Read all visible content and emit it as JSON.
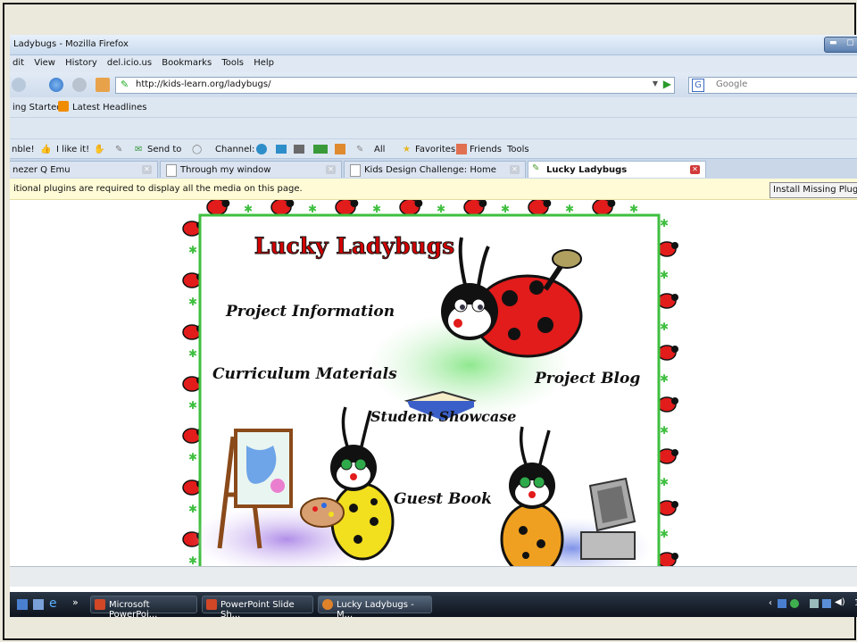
{
  "window": {
    "title": "Ladybugs - Mozilla Firefox"
  },
  "menu": [
    "dit",
    "View",
    "History",
    "del.icio.us",
    "Bookmarks",
    "Tools",
    "Help"
  ],
  "nav": {
    "url": "http://kids-learn.org/ladybugs/",
    "search_placeholder": "Google"
  },
  "bookmarks": {
    "getting_started": "ing Started",
    "latest_headlines": "Latest Headlines"
  },
  "extension_bar": {
    "stumble": "nble!",
    "i_like_it": "I like it!",
    "send_to": "Send to",
    "channel": "Channel:",
    "all": "All",
    "favorites": "Favorites",
    "friends": "Friends",
    "tools": "Tools"
  },
  "tabs": [
    {
      "label": "nezer Q Emu"
    },
    {
      "label": "Through my window"
    },
    {
      "label": "Kids Design Challenge: Home"
    },
    {
      "label": "Lucky Ladybugs"
    }
  ],
  "notification": {
    "message": "itional plugins are required to display all the media on this page.",
    "button": "Install Missing Plugins..."
  },
  "page": {
    "title": "Lucky Ladybugs",
    "links": {
      "project_information": "Project Information",
      "curriculum_materials": "Curriculum Materials",
      "project_blog": "Project Blog",
      "student_showcase": "Student Showcase",
      "guest_book": "Guest Book"
    }
  },
  "taskbar": {
    "items": [
      "Microsoft PowerPoi...",
      "PowerPoint Slide Sh...",
      "Lucky Ladybugs - M..."
    ],
    "clock": "1"
  },
  "colors": {
    "title_red": "#d40000",
    "title_outline": "#1a1a1a",
    "border_green": "#3fbf3f",
    "ladybug_red": "#e21b1b"
  }
}
